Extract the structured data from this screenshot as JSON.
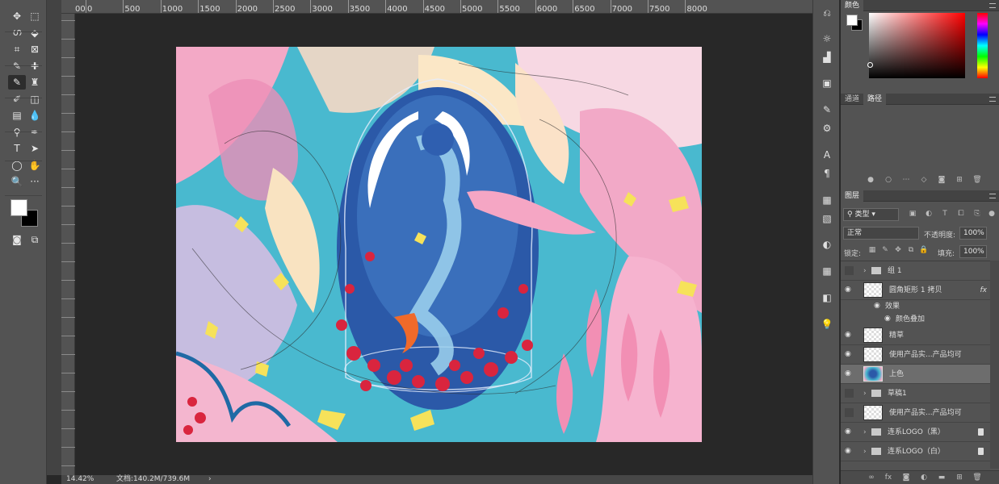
{
  "toolbar": {
    "tools": [
      {
        "icon": "move-icon",
        "glyph": "✥"
      },
      {
        "icon": "marquee-icon",
        "glyph": "⬚"
      },
      {
        "icon": "lasso-icon",
        "glyph": "ഗ"
      },
      {
        "icon": "quick-select-icon",
        "glyph": "⬙"
      },
      {
        "icon": "crop-icon",
        "glyph": "⌗"
      },
      {
        "icon": "frame-icon",
        "glyph": "⊠"
      },
      {
        "icon": "eyedropper-icon",
        "glyph": "✎"
      },
      {
        "icon": "healing-icon",
        "glyph": "✚"
      },
      {
        "icon": "brush-icon",
        "glyph": "✎"
      },
      {
        "icon": "stamp-icon",
        "glyph": "♜"
      },
      {
        "icon": "history-brush-icon",
        "glyph": "✐"
      },
      {
        "icon": "eraser-icon",
        "glyph": "◫"
      },
      {
        "icon": "gradient-icon",
        "glyph": "▤"
      },
      {
        "icon": "blur-icon",
        "glyph": "💧"
      },
      {
        "icon": "dodge-icon",
        "glyph": "⚲"
      },
      {
        "icon": "pen-icon",
        "glyph": "✒"
      },
      {
        "icon": "type-icon",
        "glyph": "T"
      },
      {
        "icon": "path-select-icon",
        "glyph": "➤"
      },
      {
        "icon": "ellipse-icon",
        "glyph": "◯"
      },
      {
        "icon": "hand-icon",
        "glyph": "✋"
      },
      {
        "icon": "zoom-icon",
        "glyph": "🔍"
      },
      {
        "icon": "more-icon",
        "glyph": "···"
      }
    ],
    "bottom": [
      {
        "icon": "quick-mask-icon",
        "glyph": "◙"
      },
      {
        "icon": "screen-mode-icon",
        "glyph": "⧉"
      }
    ]
  },
  "ruler": {
    "labels": [
      "0",
      "500",
      "1000",
      "1500",
      "2000",
      "2500",
      "3000",
      "3500",
      "4000",
      "4500",
      "5000",
      "5500",
      "6000",
      "6500",
      "7000",
      "7500",
      "8000"
    ],
    "lead_label": "00"
  },
  "status": {
    "zoom": "14.42%",
    "doc": "文档:140.2M/739.6M",
    "arrow": "›"
  },
  "iconstrip": [
    {
      "icon": "history-icon",
      "glyph": "⎌"
    },
    {
      "icon": "adjustments-icon",
      "glyph": "☼"
    },
    {
      "icon": "levels-icon",
      "glyph": "▟"
    },
    {
      "icon": "libraries-icon",
      "glyph": "▣"
    },
    {
      "icon": "brush-settings-icon",
      "glyph": "✎"
    },
    {
      "icon": "brush-presets-icon",
      "glyph": "⚙"
    },
    {
      "icon": "character-icon",
      "glyph": "A"
    },
    {
      "icon": "paragraph-icon",
      "glyph": "¶"
    },
    {
      "icon": "table-icon",
      "glyph": "▦"
    },
    {
      "icon": "swatches-icon",
      "glyph": "▧"
    },
    {
      "icon": "styles-icon",
      "glyph": "◐"
    },
    {
      "icon": "grid-icon",
      "glyph": "▦"
    },
    {
      "icon": "navigator-icon",
      "glyph": "◧"
    },
    {
      "icon": "light-icon",
      "glyph": "💡"
    }
  ],
  "color_panel": {
    "title": "颜色",
    "fg": "#ffffff",
    "bg": "#000000"
  },
  "paths_panel": {
    "tab_channels": "通道",
    "tab_paths": "路径"
  },
  "layers_panel": {
    "title": "图层",
    "filter_label": "类型",
    "blend_mode": "正常",
    "opacity_label": "不透明度:",
    "opacity_value": "100%",
    "lock_label": "锁定:",
    "fill_label": "填充:",
    "fill_value": "100%",
    "layers": [
      {
        "name": "组 1",
        "type": "group",
        "visible": false
      },
      {
        "name": "圆角矩形 1 拷贝",
        "type": "layer",
        "visible": true,
        "fx": "fx"
      },
      {
        "name": "效果",
        "type": "effect"
      },
      {
        "name": "颜色叠加",
        "type": "effect2"
      },
      {
        "name": "精草",
        "type": "layer",
        "visible": true
      },
      {
        "name": "使用产品实...产品均可",
        "type": "smart",
        "visible": true
      },
      {
        "name": "上色",
        "type": "art",
        "visible": true,
        "selected": true
      },
      {
        "name": "草稿1",
        "type": "group",
        "visible": false
      },
      {
        "name": "使用产品实...产品均可",
        "type": "smart",
        "visible": false
      },
      {
        "name": "连系LOGO（黑）",
        "type": "group",
        "visible": true,
        "locked": true
      },
      {
        "name": "连系LOGO（白）",
        "type": "group",
        "visible": true,
        "locked": true
      }
    ]
  }
}
